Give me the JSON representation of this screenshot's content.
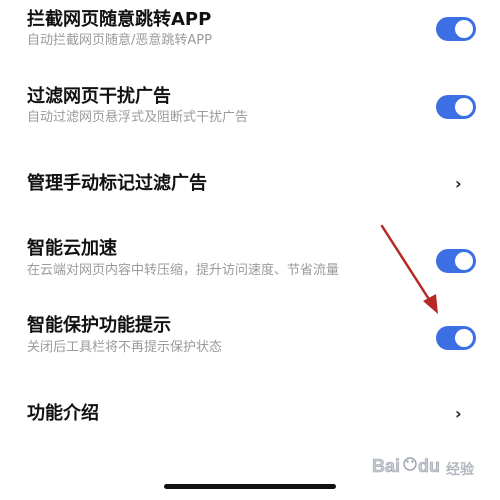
{
  "settings": {
    "items": [
      {
        "title": "拦截网页随意跳转APP",
        "subtitle": "自动拦截网页随意/恶意跳转APP",
        "control": "toggle",
        "enabled": true
      },
      {
        "title": "过滤网页干扰广告",
        "subtitle": "自动过滤网页悬浮式及阻断式干扰广告",
        "control": "toggle",
        "enabled": true
      },
      {
        "title": "管理手动标记过滤广告",
        "control": "chevron",
        "chevron": "›"
      },
      {
        "title": "智能云加速",
        "subtitle": "在云端对网页内容中转压缩，提升访问速度、节省流量",
        "control": "toggle",
        "enabled": true
      },
      {
        "title": "智能保护功能提示",
        "subtitle": "关闭后工具栏将不再提示保护状态",
        "control": "toggle",
        "enabled": true
      },
      {
        "title": "功能介绍",
        "control": "chevron",
        "chevron": "›"
      }
    ]
  },
  "colors": {
    "toggle_on": "#3c6fe4",
    "arrow": "#b52a24",
    "title": "#111111",
    "subtitle": "#9a9a9a"
  },
  "watermark": {
    "logo": "Baidu",
    "text": "经验"
  }
}
